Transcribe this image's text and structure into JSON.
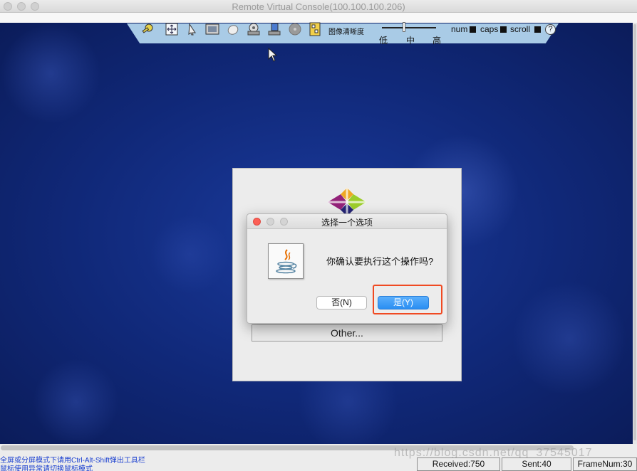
{
  "window": {
    "title": "Remote Virtual Console(100.100.100.206)"
  },
  "toolbar": {
    "icons": [
      "key-icon",
      "move-icon",
      "pointer-icon",
      "film-icon",
      "mouse-icon",
      "cd-drive-icon",
      "floppy-icon",
      "disc-icon",
      "image-file-icon"
    ],
    "quality_label": "图像清晰度",
    "slider_labels": {
      "low": "低",
      "mid": "中",
      "high": "高"
    },
    "locks": {
      "num": "num",
      "caps": "caps",
      "scroll": "scroll"
    },
    "help": "?"
  },
  "background_panel": {
    "other_button": "Other..."
  },
  "dialog": {
    "title": "选择一个选项",
    "message": "你确认要执行这个操作吗?",
    "no_button": "否(N)",
    "yes_button": "是(Y)"
  },
  "statusbar": {
    "hint1": "全屏或分屏模式下请用Ctrl-Alt-Shift弹出工具栏",
    "hint2": "鼠标使用异常请切换鼠标模式",
    "received": "Received:750",
    "sent": "Sent:40",
    "framenum": "FrameNum:30"
  },
  "watermark": "https://blog.csdn.net/qq_37545017",
  "colors": {
    "toolbar": "#a9cbe6",
    "desktop": "#102878",
    "yes_button": "#2a8ef2",
    "highlight": "#f04a22",
    "hint_text": "#1a3fd0"
  }
}
